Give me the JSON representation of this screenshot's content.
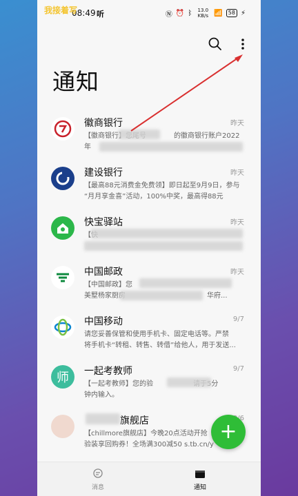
{
  "watermark": "我接着写",
  "status": {
    "time": "08:49",
    "app_glyph": "听",
    "speed": "13.0 KB/s",
    "battery": "58"
  },
  "page_title": "通知",
  "notifications": [
    {
      "name": "徽商银行",
      "time": "昨天",
      "line1": "【徽商银行】您尾号",
      "line1b": "的徽商银行账户2022年",
      "line2": "09"
    },
    {
      "name": "建设银行",
      "time": "昨天",
      "line1": "【最高88元消费金免费领】即日起至9月9日，参与",
      "line2": "“月月享金喜”活动，100%中奖，最高得88元"
    },
    {
      "name": "快宝驿站",
      "time": "昨天",
      "line1": "【快",
      "line2": ""
    },
    {
      "name": "中国邮政",
      "time": "昨天",
      "line1": "【中国邮政】您",
      "line2": "美墅杨家厨房",
      "line2b": "华府..."
    },
    {
      "name": "中国移动",
      "time": "9/7",
      "line1": "请您妥善保管和使用手机卡、固定电话等。严禁",
      "line2": "将手机卡“转租、转售、转借”给他人，用于发送..."
    },
    {
      "name": "一起考教师",
      "time": "9/7",
      "line1": "【一起考教师】您的验",
      "line1b": "请于5分",
      "line2": "钟内输入。"
    },
    {
      "name": "旗舰店",
      "time": "9/6",
      "line1": "【chillmore旗舰店】今晚20点活动开抢",
      "line2": "验装享回购券！全场满300减50 s.tb.cn/y"
    }
  ],
  "nav": {
    "left_label": "消息",
    "right_label": "通知"
  },
  "colors": {
    "accent": "#2fbd37",
    "annotation": "#d93030"
  }
}
